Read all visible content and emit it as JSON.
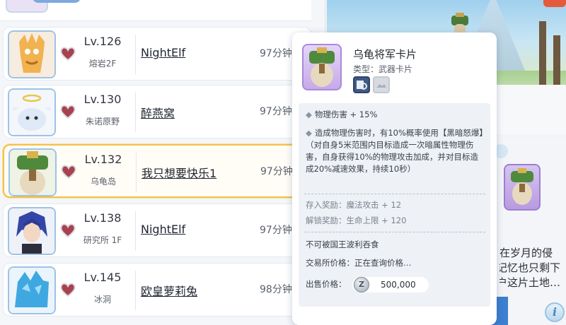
{
  "rows": [
    {
      "level": "Lv.126",
      "map": "熔岩2F",
      "player": "NightElf",
      "time": "97分钟"
    },
    {
      "level": "Lv.130",
      "map": "朱诺原野",
      "player": "醉燕窝",
      "time": "97分钟"
    },
    {
      "level": "Lv.132",
      "map": "乌龟岛",
      "player": "我只想要快乐1",
      "time": "97分钟"
    },
    {
      "level": "Lv.138",
      "map": "研究所 1F",
      "player": "NightElf",
      "time": "97分钟"
    },
    {
      "level": "Lv.145",
      "map": "冰洞",
      "player": "欧皇萝莉兔",
      "time": "98分钟"
    }
  ],
  "tooltip": {
    "title": "乌龟将军卡片",
    "type": "类型：武器卡片",
    "effect1": "物理伤害 + 15%",
    "effect2": "造成物理伤害时，有10%概率使用【黑暗怒爆】（对自身5米范围内目标造成一次暗属性物理伤害，自身获得10%的物理攻击加成，并对目标造成20%减速效果，持续10秒）",
    "deposit_reward": "存入奖励：魔法攻击 + 12",
    "unlock_reward": "解锁奖励：生命上限 + 120",
    "note": "不可被国王波利吞食",
    "exchange_price": "交易所价格：正在查询价格…",
    "sell_label": "出售价格：",
    "coin_symbol": "Z",
    "sell_price": "500,000"
  },
  "story_text": "在岁月的侵\n记忆也只剩下\n户这片土地…",
  "info_button": "i",
  "colors": {
    "selected_border": "#f2c14a",
    "avatar_border": "#9fc2e6",
    "card_frame": "#a98ad8",
    "heart": "#a8424e"
  }
}
